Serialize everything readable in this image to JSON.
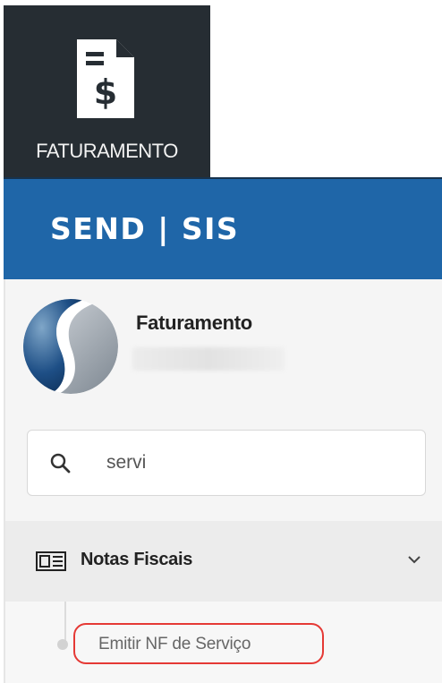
{
  "tile": {
    "label": "FATURAMENTO",
    "icon": "invoice-dollar-icon"
  },
  "header": {
    "brand": "SEND | SIS"
  },
  "profile": {
    "name": "Faturamento"
  },
  "search": {
    "value": "servi",
    "icon": "search-icon"
  },
  "nav": {
    "group": {
      "label": "Notas Fiscais",
      "icon": "newspaper-icon",
      "expand_icon": "chevron-down-icon"
    },
    "items": [
      {
        "label": "Emitir NF de Serviço"
      }
    ]
  },
  "colors": {
    "header": "#1f66a8",
    "tile": "#262d33",
    "highlight": "#e53935"
  }
}
